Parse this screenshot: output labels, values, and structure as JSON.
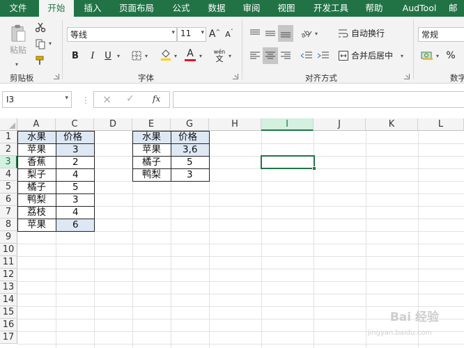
{
  "tabs": [
    {
      "label": "文件",
      "active": false
    },
    {
      "label": "开始",
      "active": true
    },
    {
      "label": "插入",
      "active": false
    },
    {
      "label": "页面布局",
      "active": false
    },
    {
      "label": "公式",
      "active": false
    },
    {
      "label": "数据",
      "active": false
    },
    {
      "label": "审阅",
      "active": false
    },
    {
      "label": "视图",
      "active": false
    },
    {
      "label": "开发工具",
      "active": false
    },
    {
      "label": "帮助",
      "active": false
    },
    {
      "label": "AudTool",
      "active": false
    },
    {
      "label": "邮",
      "active": false
    }
  ],
  "ribbon": {
    "clipboard": {
      "group_label": "剪贴板",
      "paste_label": "粘贴",
      "icons": [
        "paste-icon",
        "cut-icon",
        "copy-icon",
        "format-painter-icon"
      ]
    },
    "font": {
      "group_label": "字体",
      "font_name": "等线",
      "font_size": "11",
      "bold": "B",
      "italic": "I",
      "underline": "U",
      "grow": "A",
      "shrink": "A",
      "color_letter": "A",
      "phonetic_top": "wén",
      "phonetic_bottom": "文",
      "font_color": "#e81123",
      "fill_color": "#ffd200"
    },
    "alignment": {
      "group_label": "对齐方式",
      "wrap_text": "自动换行",
      "merge_center": "合并后居中"
    },
    "number": {
      "group_label": "数字",
      "format": "常规",
      "percent": "%"
    }
  },
  "formula_bar": {
    "name_box": "I3",
    "cancel_icon": "×",
    "enter_icon": "✓",
    "fx_label": "fx",
    "formula": ""
  },
  "sheet": {
    "columns": [
      "A",
      "C",
      "D",
      "E",
      "G",
      "H",
      "I",
      "J",
      "K",
      "L"
    ],
    "selected_column": "I",
    "rows": [
      "1",
      "2",
      "3",
      "4",
      "5",
      "6",
      "7",
      "8",
      "9",
      "10",
      "11",
      "12",
      "13",
      "14",
      "15",
      "16",
      "17"
    ],
    "active_cell": "I3",
    "table1": {
      "header": [
        "水果",
        "价格"
      ],
      "rows": [
        [
          "苹果",
          "3"
        ],
        [
          "香蕉",
          "2"
        ],
        [
          "梨子",
          "4"
        ],
        [
          "橘子",
          "5"
        ],
        [
          "鸭梨",
          "3"
        ],
        [
          "荔枝",
          "4"
        ],
        [
          "苹果",
          "6"
        ]
      ]
    },
    "table2": {
      "header": [
        "水果",
        "价格"
      ],
      "rows": [
        [
          "苹果",
          "3,6"
        ],
        [
          "橘子",
          "5"
        ],
        [
          "鸭梨",
          "3"
        ]
      ]
    }
  },
  "watermark": {
    "text": "Bai 经验",
    "sub": "jingyan.baidu.com"
  }
}
